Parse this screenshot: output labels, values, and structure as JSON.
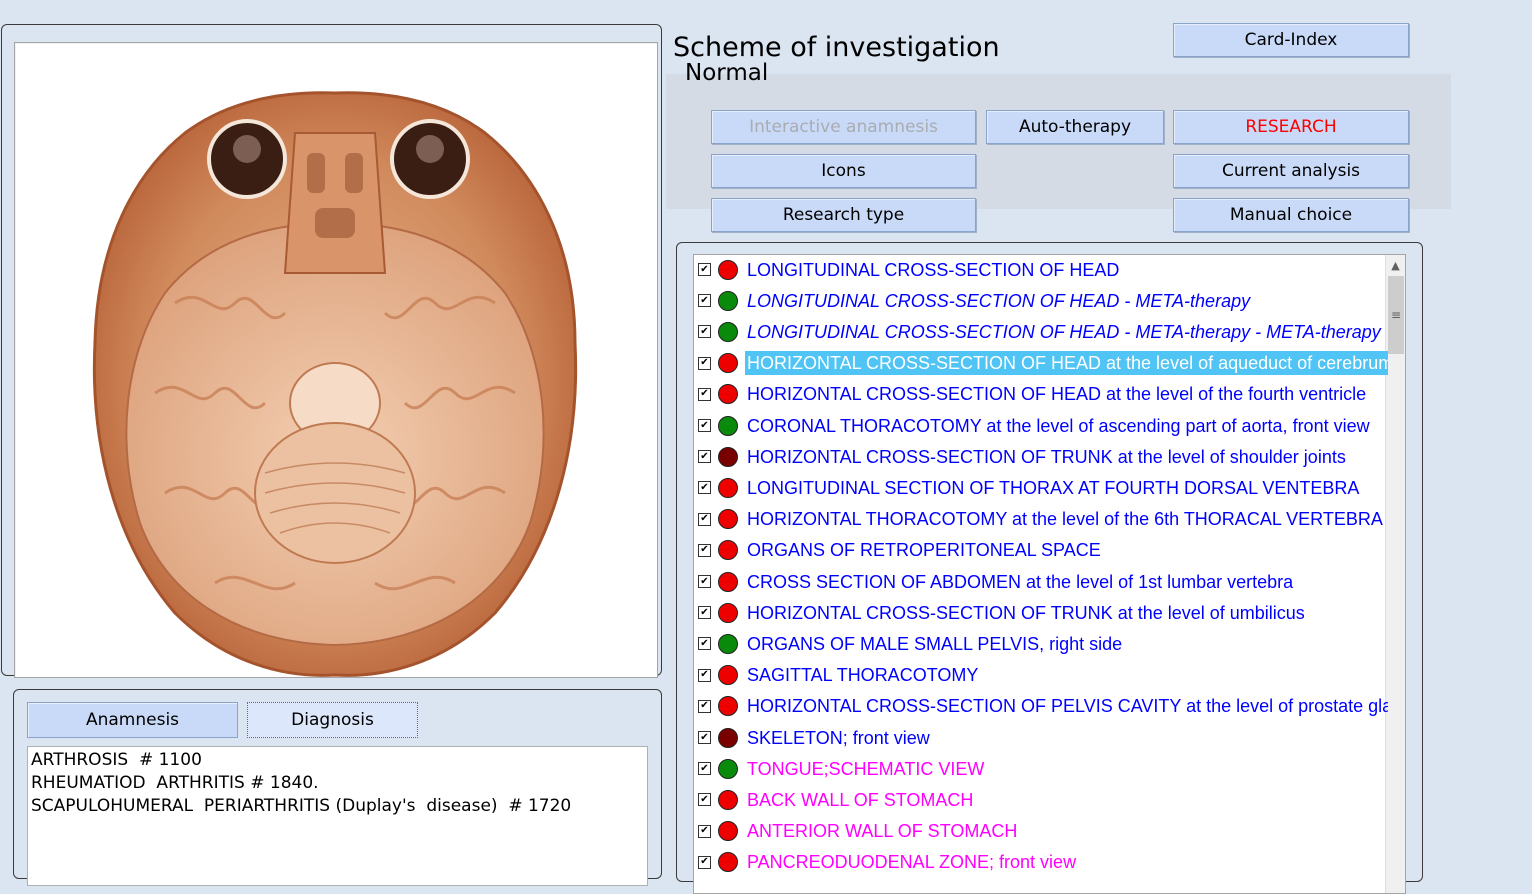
{
  "header": {
    "title": "Scheme of investigation",
    "status": "Normal"
  },
  "buttons": {
    "card_index": "Card-Index",
    "interactive_anamnesis": "Interactive anamnesis",
    "auto_therapy": "Auto-therapy",
    "research": "RESEARCH",
    "icons": "Icons",
    "current_analysis": "Current analysis",
    "research_type": "Research type",
    "manual_choice": "Manual choice"
  },
  "tabs": {
    "anamnesis": "Anamnesis",
    "diagnosis": "Diagnosis"
  },
  "diagnosis_lines": [
    "ARTHROSIS  # 1100",
    "RHEUMATIOD  ARTHRITIS # 1840.",
    "SCAPULOHUMERAL  PERIARTHRITIS (Duplay's  disease)  # 1720"
  ],
  "colors": {
    "red": "#ee0000",
    "green": "#0a8a0a",
    "dark_red": "#7a0000",
    "blue_text": "#0000ff",
    "magenta_text": "#ff00ff"
  },
  "investigations": [
    {
      "label": "LONGITUDINAL CROSS-SECTION OF HEAD",
      "checked": true,
      "dot": "red",
      "text_color": "blue",
      "italic": false,
      "selected": false
    },
    {
      "label": "LONGITUDINAL CROSS-SECTION OF HEAD - META-therapy",
      "checked": true,
      "dot": "green",
      "text_color": "blue",
      "italic": true,
      "selected": false
    },
    {
      "label": "LONGITUDINAL CROSS-SECTION OF HEAD - META-therapy - META-therapy",
      "checked": true,
      "dot": "green",
      "text_color": "blue",
      "italic": true,
      "selected": false
    },
    {
      "label": "HORIZONTAL CROSS-SECTION OF HEAD at the level of aqueduct of cerebrum",
      "checked": true,
      "dot": "red",
      "text_color": "blue",
      "italic": false,
      "selected": true
    },
    {
      "label": "HORIZONTAL CROSS-SECTION OF HEAD at the level of the fourth ventricle",
      "checked": true,
      "dot": "red",
      "text_color": "blue",
      "italic": false,
      "selected": false
    },
    {
      "label": "CORONAL THORACOTOMY at the level of ascending part of aorta, front view",
      "checked": true,
      "dot": "green",
      "text_color": "blue",
      "italic": false,
      "selected": false
    },
    {
      "label": "HORIZONTAL CROSS-SECTION OF TRUNK at the level of shoulder joints",
      "checked": true,
      "dot": "dark_red",
      "text_color": "blue",
      "italic": false,
      "selected": false
    },
    {
      "label": "LONGITUDINAL  SECTION  OF  THORAX  AT  FOURTH  DORSAL  VENTEBRA",
      "checked": true,
      "dot": "red",
      "text_color": "blue",
      "italic": false,
      "selected": false
    },
    {
      "label": "HORIZONTAL THORACOTOMY at the level of the 6th THORACAL VERTEBRA",
      "checked": true,
      "dot": "red",
      "text_color": "blue",
      "italic": false,
      "selected": false
    },
    {
      "label": "ORGANS OF RETROPERITONEAL SPACE",
      "checked": true,
      "dot": "red",
      "text_color": "blue",
      "italic": false,
      "selected": false
    },
    {
      "label": "CROSS SECTION OF ABDOMEN at the level of 1st lumbar vertebra",
      "checked": true,
      "dot": "red",
      "text_color": "blue",
      "italic": false,
      "selected": false
    },
    {
      "label": "HORIZONTAL CROSS-SECTION OF TRUNK at the level of umbilicus",
      "checked": true,
      "dot": "red",
      "text_color": "blue",
      "italic": false,
      "selected": false
    },
    {
      "label": "ORGANS OF MALE SMALL PELVIS, right side",
      "checked": true,
      "dot": "green",
      "text_color": "blue",
      "italic": false,
      "selected": false
    },
    {
      "label": "SAGITTAL THORACOTOMY",
      "checked": true,
      "dot": "red",
      "text_color": "blue",
      "italic": false,
      "selected": false
    },
    {
      "label": "HORIZONTAL CROSS-SECTION OF PELVIS CAVITY at the level of prostate gland",
      "checked": true,
      "dot": "red",
      "text_color": "blue",
      "italic": false,
      "selected": false
    },
    {
      "label": "SKELETON;  front  view",
      "checked": true,
      "dot": "dark_red",
      "text_color": "blue",
      "italic": false,
      "selected": false
    },
    {
      "label": "TONGUE;SCHEMATIC VIEW",
      "checked": true,
      "dot": "green",
      "text_color": "magenta",
      "italic": false,
      "selected": false
    },
    {
      "label": "BACK WALL OF STOMACH",
      "checked": true,
      "dot": "red",
      "text_color": "magenta",
      "italic": false,
      "selected": false
    },
    {
      "label": "ANTERIOR  WALL  OF  STOMACH",
      "checked": true,
      "dot": "red",
      "text_color": "magenta",
      "italic": false,
      "selected": false
    },
    {
      "label": "PANCREODUODENAL  ZONE;  front  view",
      "checked": true,
      "dot": "red",
      "text_color": "magenta",
      "italic": false,
      "selected": false
    }
  ]
}
